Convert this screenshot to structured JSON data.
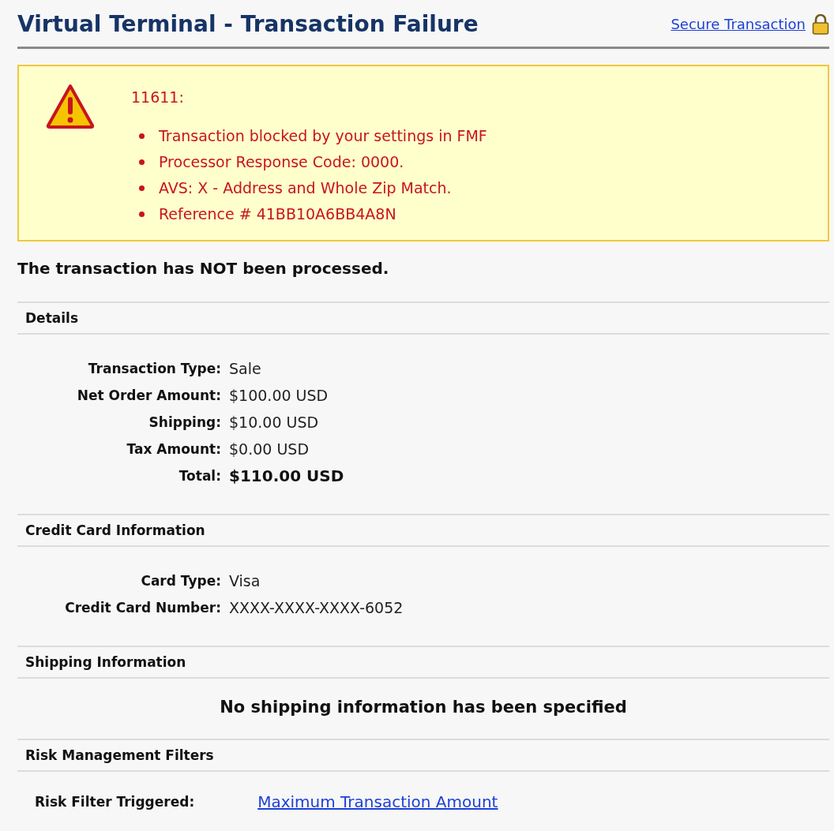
{
  "header": {
    "title": "Virtual Terminal - Transaction Failure",
    "secure_link": "Secure Transaction"
  },
  "alert": {
    "code": "11611:",
    "messages": [
      "Transaction blocked by your settings in FMF",
      "Processor Response Code: 0000.",
      "AVS: X - Address and Whole Zip Match.",
      "Reference # 41BB10A6BB4A8N"
    ]
  },
  "status": "The transaction has NOT been processed.",
  "sections": [
    {
      "title": "Details",
      "kind": "fields",
      "fields": [
        {
          "label": "Transaction Type:",
          "value": "Sale",
          "emphasis": false
        },
        {
          "label": "Net Order Amount:",
          "value": "$100.00 USD",
          "emphasis": false
        },
        {
          "label": "Shipping:",
          "value": "$10.00 USD",
          "emphasis": false
        },
        {
          "label": "Tax Amount:",
          "value": "$0.00 USD",
          "emphasis": false
        },
        {
          "label": "Total:",
          "value": "$110.00 USD",
          "emphasis": true
        }
      ]
    },
    {
      "title": "Credit Card Information",
      "kind": "fields",
      "fields": [
        {
          "label": "Card Type:",
          "value": "Visa",
          "emphasis": false
        },
        {
          "label": "Credit Card Number:",
          "value": "XXXX-XXXX-XXXX-6052",
          "emphasis": false
        }
      ]
    },
    {
      "title": "Shipping Information",
      "kind": "message",
      "message": "No shipping information has been specified"
    },
    {
      "title": "Risk Management Filters",
      "kind": "link-row",
      "label": "Risk Filter Triggered:",
      "link": "Maximum Transaction Amount"
    }
  ]
}
